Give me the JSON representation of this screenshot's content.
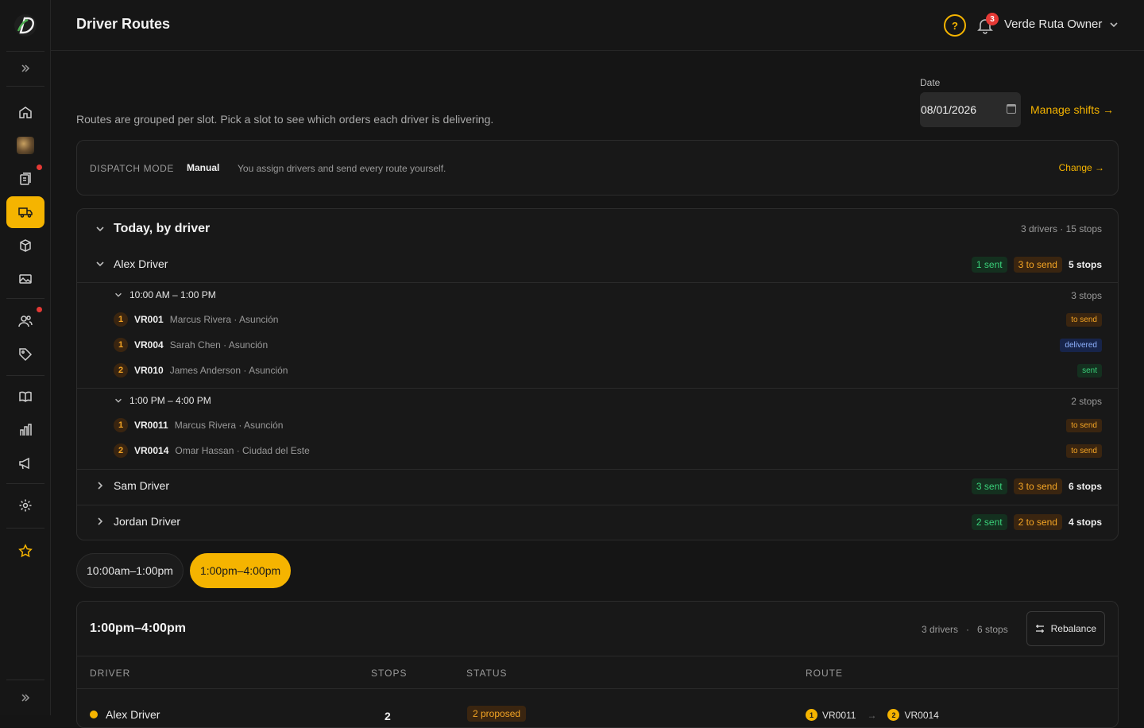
{
  "header": {
    "title": "Driver Routes",
    "help_symbol": "?",
    "notifications_count": "3",
    "user_name": "Verde Ruta Owner"
  },
  "sidebar": {
    "items": [
      {
        "icon": "home-icon"
      },
      {
        "icon": "store-avatar"
      },
      {
        "icon": "orders-icon",
        "has_alert": true
      },
      {
        "icon": "truck-icon",
        "active": true
      },
      {
        "icon": "box-icon"
      },
      {
        "icon": "image-icon"
      },
      {
        "icon": "users-icon",
        "has_alert": true
      },
      {
        "icon": "tag-icon"
      },
      {
        "icon": "book-icon"
      },
      {
        "icon": "chart-icon"
      },
      {
        "icon": "megaphone-icon"
      },
      {
        "icon": "gear-icon"
      },
      {
        "icon": "star-icon"
      }
    ]
  },
  "main": {
    "subtitle": "Routes are grouped per slot. Pick a slot to see which orders each driver is delivering.",
    "date_label": "Date",
    "date_value": "08/01/2026",
    "manage_shifts": "Manage shifts →"
  },
  "dispatch": {
    "label": "DISPATCH MODE",
    "mode": "Manual",
    "description": "You assign drivers and send every route yourself.",
    "change": "Change →"
  },
  "today": {
    "title": "Today, by driver",
    "meta": "3 drivers · 15 stops",
    "drivers": [
      {
        "name": "Alex Driver",
        "sent": "1 sent",
        "to_send": "3 to send",
        "stops": "5 stops",
        "slots": [
          {
            "time": "10:00 AM – 1:00 PM",
            "stops": "3 stops",
            "orders": [
              {
                "num": "1",
                "code": "VR001",
                "meta": "Marcus Rivera · Asunción",
                "status": "to send"
              },
              {
                "num": "1",
                "code": "VR004",
                "meta": "Sarah Chen · Asunción",
                "status": "delivered"
              },
              {
                "num": "2",
                "code": "VR010",
                "meta": "James Anderson · Asunción",
                "status": "sent"
              }
            ]
          },
          {
            "time": "1:00 PM – 4:00 PM",
            "stops": "2 stops",
            "orders": [
              {
                "num": "1",
                "code": "VR0011",
                "meta": "Marcus Rivera · Asunción",
                "status": "to send"
              },
              {
                "num": "2",
                "code": "VR0014",
                "meta": "Omar Hassan · Ciudad del Este",
                "status": "to send"
              }
            ]
          }
        ]
      },
      {
        "name": "Sam Driver",
        "sent": "3 sent",
        "to_send": "3 to send",
        "stops": "6 stops"
      },
      {
        "name": "Jordan Driver",
        "sent": "2 sent",
        "to_send": "2 to send",
        "stops": "4 stops"
      }
    ]
  },
  "slot_tabs": [
    {
      "label": "10:00am–1:00pm",
      "active": false
    },
    {
      "label": "1:00pm–4:00pm",
      "active": true
    }
  ],
  "slot_detail": {
    "title": "1:00pm–4:00pm",
    "drivers": "3 drivers",
    "dot": "·",
    "stops": "6 stops",
    "rebalance": "Rebalance",
    "columns": [
      "DRIVER",
      "STOPS",
      "STATUS",
      "ROUTE"
    ],
    "rows": [
      {
        "driver": "Alex Driver",
        "stops": "2",
        "status": "2 proposed",
        "route": [
          {
            "num": "1",
            "code": "VR0011"
          },
          {
            "num": "2",
            "code": "VR0014"
          }
        ],
        "route_arrow": "→"
      }
    ]
  },
  "colors": {
    "accent": "#f5b400",
    "sent": "#3ad17a",
    "to_send": "#f5a524",
    "delivered": "#8fb2ff",
    "alert": "#e53935"
  }
}
